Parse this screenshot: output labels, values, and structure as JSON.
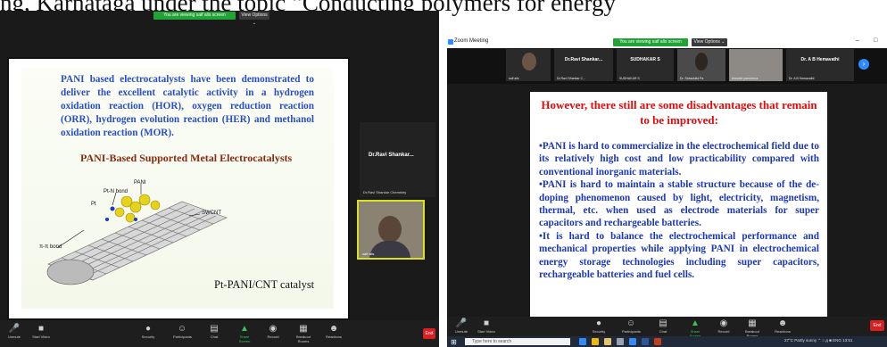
{
  "document_text": "ng, Karnataga under the topic “Conducting polymers for energy",
  "left": {
    "share_banner": "You are viewing saif alis screen",
    "view_options": "View Options ⌄",
    "slide": {
      "paragraph": "PANI based electrocatalysts have been demonstrated to deliver the excellent catalytic activity in a hydrogen oxidation reaction (HOR), oxygen reduction reaction (ORR), hydrogen evolution reaction (HER) and methanol oxidation reaction (MOR).",
      "subtitle": "PANI-Based Supported Metal Electrocatalysts",
      "labels": {
        "pani": "PANI",
        "ptn": "Pt-N bond",
        "pt": "Pt",
        "swcnt": "SWCNT",
        "pipi": "π-π bond"
      },
      "caption": "Pt-PANI/CNT catalyst"
    },
    "participant_tile": {
      "name": "Dr.Ravi  Shankar...",
      "sub": "Dr.Ravi Shankar Chemistry"
    },
    "video_tile": {
      "name": "saif alis"
    },
    "toolbar": [
      {
        "icon": "🎤",
        "label": "Unmute"
      },
      {
        "icon": "■",
        "label": "Start Video"
      },
      {
        "icon": "●",
        "label": "Security"
      },
      {
        "icon": "☺",
        "label": "Participants"
      },
      {
        "icon": "▤",
        "label": "Chat"
      },
      {
        "icon": "▲",
        "label": "Share Screen"
      },
      {
        "icon": "◉",
        "label": "Record"
      },
      {
        "icon": "▦",
        "label": "Breakout Rooms"
      },
      {
        "icon": "☻",
        "label": "Reactions"
      }
    ],
    "end_label": "End"
  },
  "right": {
    "window_title": "Zoom Meeting",
    "share_banner": "You are viewing saif alis screen",
    "view_options": "View Options ⌄",
    "thumbnails": [
      {
        "name": "saif alis",
        "big": ""
      },
      {
        "name": "Dr.Ravi Shankar C...",
        "big": "Dr.Ravi Shankar..."
      },
      {
        "name": "SUDHAKAR S",
        "big": "SUDHAKAR S"
      },
      {
        "name": "Dr. Sahadulla Pa",
        "big": ""
      },
      {
        "name": "bhavani parmerma",
        "big": ""
      },
      {
        "name": "Dr. A B Hemavathi",
        "big": "Dr. A B Hemavathi"
      }
    ],
    "slide": {
      "heading": "However, there still are some disadvantages that remain to be improved:",
      "body": "•PANI is hard to commercialize in the electrochemical field due to its relatively high cost and low practicability compared with conventional inorganic materials.\n•PANI is hard to maintain a stable structure because of the de-doping phenomenon caused by light, electricity, magnetism, thermal, etc. when used as electrode materials for super capacitors and rechargeable batteries.\n•It is hard to balance the electrochemical performance and mechanical properties while applying PANI in electrochemical energy storage technologies including super capacitors, rechargeable batteries and fuel cells."
    },
    "toolbar": [
      {
        "icon": "🎤",
        "label": "Unmute"
      },
      {
        "icon": "■",
        "label": "Start Video"
      },
      {
        "icon": "●",
        "label": "Security"
      },
      {
        "icon": "☺",
        "label": "Participants"
      },
      {
        "icon": "▤",
        "label": "Chat"
      },
      {
        "icon": "▲",
        "label": "Share Screen"
      },
      {
        "icon": "◉",
        "label": "Record"
      },
      {
        "icon": "▦",
        "label": "Breakout Rooms"
      },
      {
        "icon": "☻",
        "label": "Reactions"
      }
    ],
    "end_label": "End",
    "taskbar": {
      "search_placeholder": "Type here to search",
      "tray": "27°C Partly sunny  ⌃ ○ д ■ ENG  13:51"
    },
    "colors": {
      "accent": "#2d8cff",
      "share_green": "#21a336",
      "end_red": "#d92020"
    }
  }
}
